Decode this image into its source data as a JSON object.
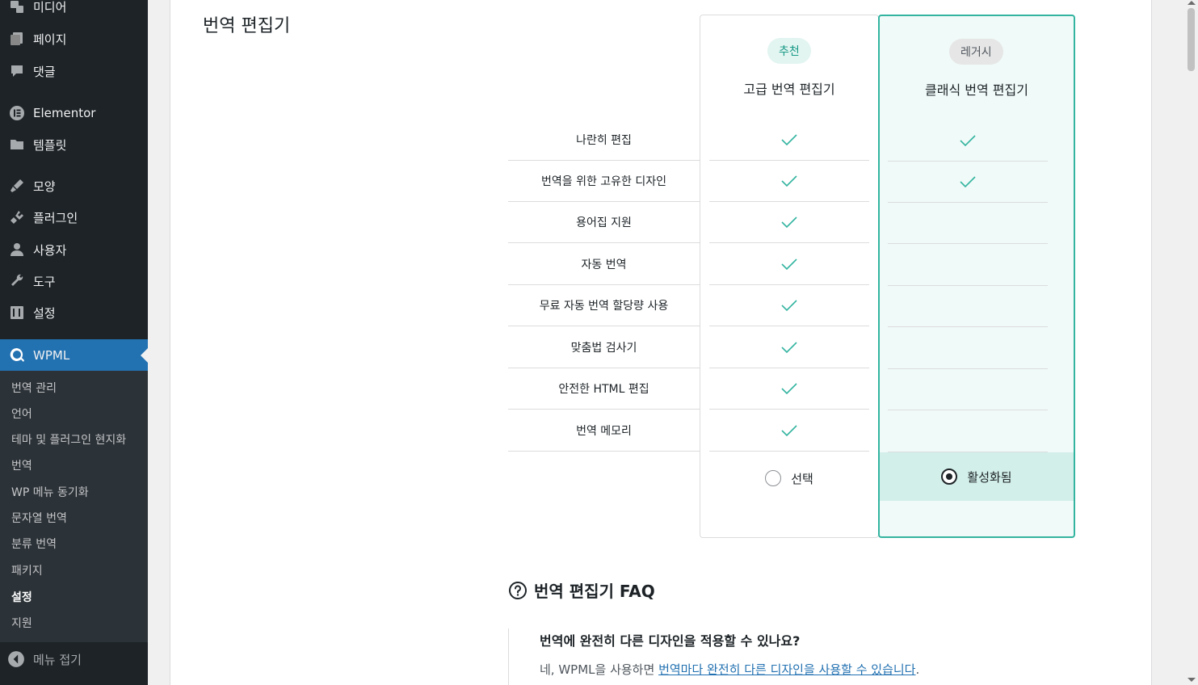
{
  "sidebar": {
    "items": [
      {
        "label": "미디어",
        "icon": "media-icon"
      },
      {
        "label": "페이지",
        "icon": "pages-icon"
      },
      {
        "label": "댓글",
        "icon": "comments-icon"
      },
      {
        "label": "Elementor",
        "icon": "elementor-icon"
      },
      {
        "label": "템플릿",
        "icon": "folder-icon"
      },
      {
        "label": "모양",
        "icon": "brush-icon"
      },
      {
        "label": "플러그인",
        "icon": "plugin-icon"
      },
      {
        "label": "사용자",
        "icon": "user-icon"
      },
      {
        "label": "도구",
        "icon": "wrench-icon"
      },
      {
        "label": "설정",
        "icon": "settings-icon"
      }
    ],
    "active": {
      "label": "WPML",
      "icon": "wpml-icon"
    },
    "submenu": [
      "번역 관리",
      "언어",
      "테마 및 플러그인 현지화",
      "번역",
      "WP 메뉴 동기화",
      "문자열 번역",
      "분류 번역",
      "패키지",
      "설정",
      "지원"
    ],
    "current_submenu": "설정",
    "collapse_label": "메뉴 접기"
  },
  "section_title": "번역 편집기",
  "features": [
    "나란히 편집",
    "번역을 위한 고유한 디자인",
    "용어집 지원",
    "자동 번역",
    "무료 자동 번역 할당량 사용",
    "맞춤법 검사기",
    "안전한 HTML 편집",
    "번역 메모리"
  ],
  "advanced": {
    "badge": "추천",
    "title": "고급 번역 편집기",
    "checks": [
      true,
      true,
      true,
      true,
      true,
      true,
      true,
      true
    ],
    "select_label": "선택",
    "selected": false
  },
  "classic": {
    "badge": "레거시",
    "title": "클래식 번역 편집기",
    "checks": [
      true,
      true,
      false,
      false,
      false,
      false,
      false,
      false
    ],
    "select_label": "활성화됨",
    "selected": true
  },
  "faq": {
    "title": "번역 편집기 FAQ",
    "question": "번역에 완전히 다른 디자인을 적용할 수 있나요?",
    "answer_prefix": "네, WPML을 사용하면 ",
    "answer_link": "번역마다 완전히 다른 디자인을 사용할 수 있습니다",
    "answer_suffix": "."
  },
  "colors": {
    "accent": "#33b4a0",
    "wp_blue": "#2271b1",
    "sidebar_bg": "#1d2327"
  }
}
